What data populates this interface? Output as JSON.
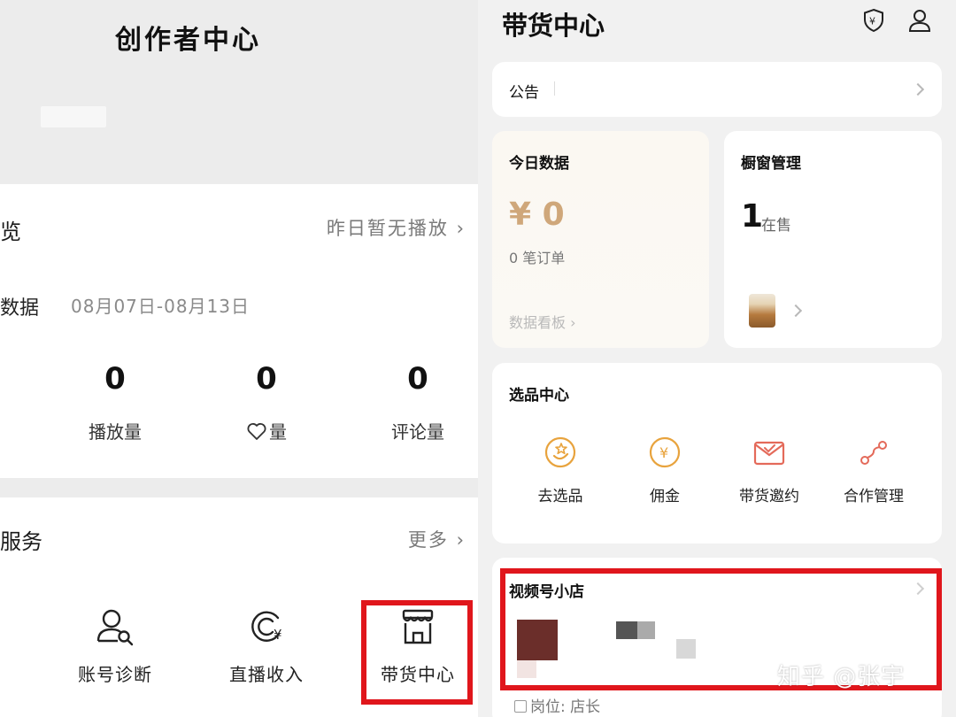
{
  "left": {
    "title": "创作者中心",
    "overview": {
      "heading": "览",
      "no_play_link": "昨日暂无播放",
      "data_label": "数据",
      "date_range": "08月07日-08月13日",
      "cut_label": "",
      "stats": [
        {
          "value": "0",
          "label": "播放量"
        },
        {
          "value": "0",
          "label": "量"
        },
        {
          "value": "0",
          "label": "评论量"
        }
      ]
    },
    "services": {
      "heading": "服务",
      "more_link": "更多",
      "items": [
        {
          "label": "账号诊断",
          "icon": "account-diagnosis-icon"
        },
        {
          "label": "直播收入",
          "icon": "live-income-icon"
        },
        {
          "label": "带货中心",
          "icon": "store-icon"
        }
      ]
    }
  },
  "right": {
    "title": "带货中心",
    "notice_label": "公告",
    "today": {
      "heading": "今日数据",
      "amount": "¥ 0",
      "orders": "0 笔订单",
      "dashboard_link": "数据看板"
    },
    "showcase": {
      "heading": "橱窗管理",
      "count": "1",
      "status": "在售"
    },
    "selection": {
      "heading": "选品中心",
      "items": [
        {
          "label": "去选品",
          "icon": "select-product-icon"
        },
        {
          "label": "佣金",
          "icon": "commission-icon"
        },
        {
          "label": "带货邀约",
          "icon": "invitation-icon"
        },
        {
          "label": "合作管理",
          "icon": "cooperation-icon"
        }
      ]
    },
    "shop": {
      "heading": "视频号小店",
      "role": "岗位: 店长"
    },
    "watermark": "知乎 @张宇"
  },
  "colors": {
    "accent_gold": "#cfa77a",
    "highlight_red": "#e0161c",
    "icon_orange": "#e8a33d",
    "icon_red": "#e46a5a"
  }
}
